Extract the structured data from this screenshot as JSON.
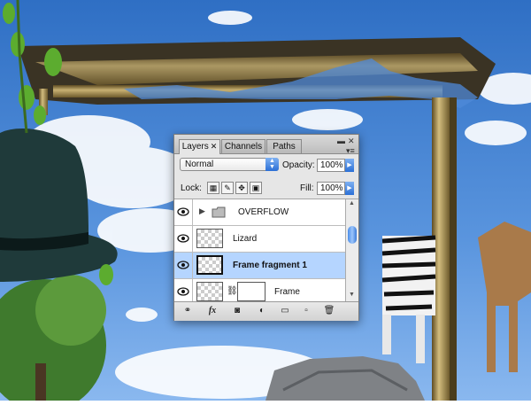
{
  "panel": {
    "tabs": [
      {
        "label": "Layers",
        "close": "✕"
      },
      {
        "label": "Channels"
      },
      {
        "label": "Paths"
      }
    ],
    "blend_mode": "Normal",
    "opacity_label": "Opacity:",
    "opacity_value": "100%",
    "lock_label": "Lock:",
    "fill_label": "Fill:",
    "fill_value": "100%",
    "layers": [
      {
        "name": "OVERFLOW",
        "type": "group"
      },
      {
        "name": "Lizard",
        "type": "layer"
      },
      {
        "name": "Frame fragment 1",
        "type": "layer",
        "selected": true
      },
      {
        "name": "Frame",
        "type": "layer-with-mask"
      }
    ],
    "bottom_buttons": [
      "link-icon",
      "fx-icon",
      "mask-icon",
      "adjustment-icon",
      "folder-icon",
      "new-layer-icon",
      "trash-icon"
    ],
    "fx_label": "fx"
  },
  "colors": {
    "sky": "#3f7fd0",
    "frame_gold": "#a88f4c",
    "selection": "#b5d5ff",
    "accent_blue": "#2b6fd6"
  }
}
